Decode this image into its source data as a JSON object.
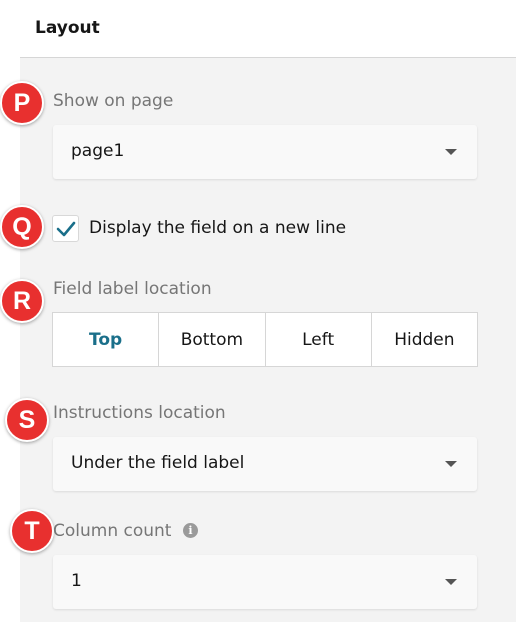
{
  "header": {
    "title": "Layout"
  },
  "markers": [
    "P",
    "Q",
    "R",
    "S",
    "T"
  ],
  "show_on_page": {
    "label": "Show on page",
    "value": "page1"
  },
  "new_line": {
    "label": "Display the field on a new line",
    "checked": true
  },
  "label_location": {
    "label": "Field label location",
    "options": [
      "Top",
      "Bottom",
      "Left",
      "Hidden"
    ],
    "selected": "Top"
  },
  "instructions_location": {
    "label": "Instructions location",
    "value": "Under the field label"
  },
  "column_count": {
    "label": "Column count",
    "value": "1"
  },
  "colors": {
    "marker": "#e8302f",
    "accent": "#1a6f8a",
    "panel": "#f3f3f3"
  },
  "icons": [
    "check-icon",
    "chevron-down-icon",
    "info-icon"
  ]
}
